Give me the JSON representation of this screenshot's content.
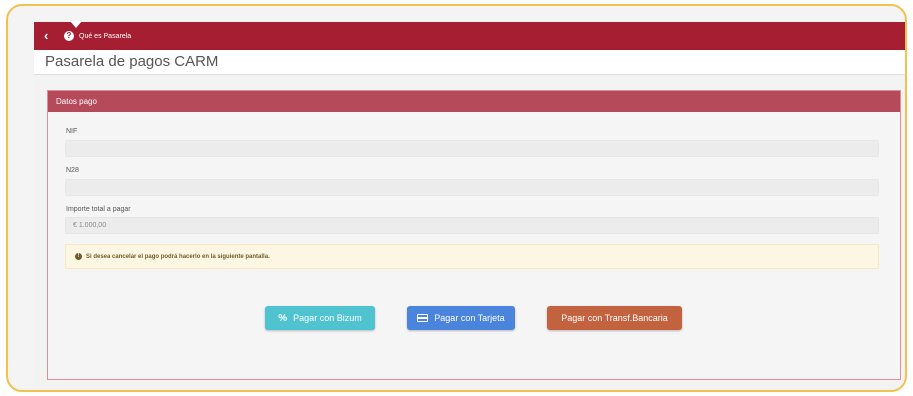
{
  "header": {
    "help_link": "Qué es Pasarela",
    "help_icon": "question-circle-icon",
    "back_icon": "chevron-left-icon",
    "brand_color": "#a51e32"
  },
  "page": {
    "title": "Pasarela de pagos CARM"
  },
  "payment_card": {
    "title": "Datos pago",
    "fields": [
      {
        "label": "NIF",
        "value": ""
      },
      {
        "label": "N28",
        "value": ""
      },
      {
        "label": "Importe total a pagar",
        "value": "€ 1.000,00"
      }
    ],
    "info_message": "Si desea cancelar el pago podrá hacerlo en la siguiente pantalla.",
    "info_icon": "info-circle-icon"
  },
  "actions": {
    "bizum": {
      "label": "Pagar con Bizum",
      "icon": "bizum-icon",
      "color": "#4fc3cf"
    },
    "tarjeta": {
      "label": "Pagar con Tarjeta",
      "icon": "credit-card-icon",
      "color": "#4a84dc"
    },
    "transferencia": {
      "label": "Pagar con Transf.Bancaria",
      "color": "#c2623f"
    }
  }
}
